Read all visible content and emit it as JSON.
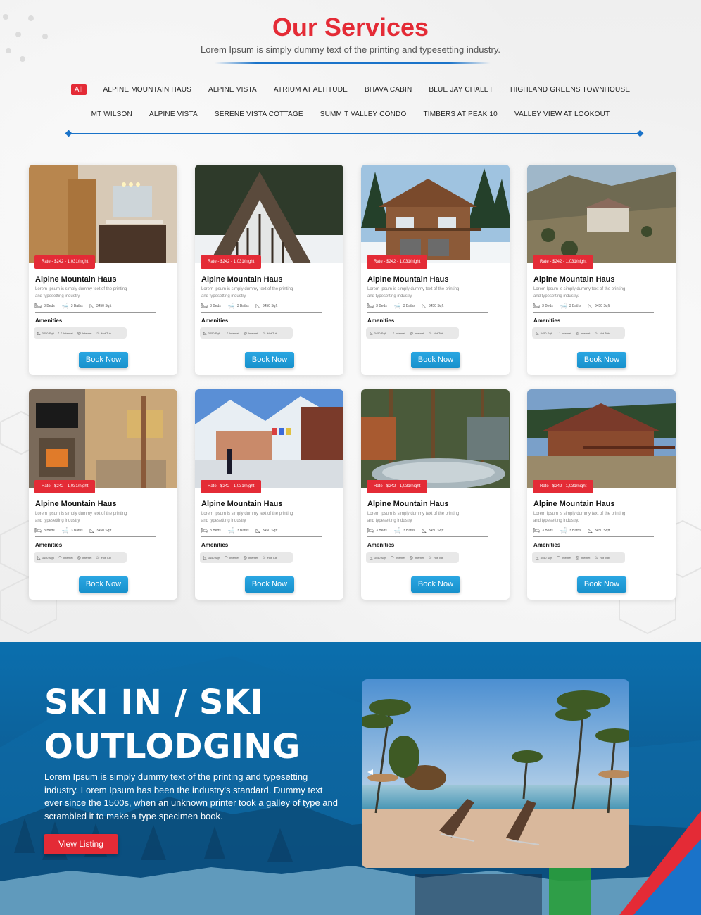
{
  "header": {
    "title": "Our Services",
    "subtitle": "Lorem Ipsum is simply dummy text of the printing and typesetting industry."
  },
  "filters": {
    "row1": [
      "All",
      "ALPINE MOUNTAIN HAUS",
      "ALPINE VISTA",
      "ATRIUM AT ALTITUDE",
      "BHAVA CABIN",
      "BLUE JAY CHALET",
      "HIGHLAND GREENS TOWNHOUSE"
    ],
    "row2": [
      "MT WILSON",
      "ALPINE VISTA",
      "SERENE VISTA COTTAGE",
      "SUMMIT VALLEY CONDO",
      "TIMBERS AT PEAK 10",
      "VALLEY VIEW AT LOOKOUT"
    ],
    "active": "All"
  },
  "card": {
    "rate": "Rate - $242 - 1,031/night",
    "title": "Alpine Mountain Haus",
    "desc": "Lorem Ipsum is simply dummy text of the printing and typesetting industry.",
    "specs": {
      "beds": "3 Beds",
      "baths": "3 Baths",
      "area": "3450 Sqft"
    },
    "amenities_title": "Amenities",
    "amenities": {
      "area": "3450 Sqft",
      "wifi": "Internet",
      "internet": "Internet",
      "hottub": "Hot Tub"
    },
    "book_label": "Book Now"
  },
  "banner": {
    "title": "SKI IN / SKI OUTLODGING",
    "text": "Lorem Ipsum is simply dummy text of the printing and typesetting industry. Lorem Ipsum has been the industry's standard. Dummy text ever since the 1500s, when an unknown printer took a galley of type and scrambled it to make a type specimen book.",
    "button": "View Listing"
  },
  "colors": {
    "accent_red": "#e42b36",
    "accent_blue": "#1a73c9",
    "button_blue": "#1891cc"
  },
  "icons": {
    "beds": "bed-icon",
    "baths": "bath-icon",
    "area": "area-icon",
    "wifi": "wifi-icon",
    "internet": "internet-icon",
    "hottub": "hot-tub-icon"
  }
}
